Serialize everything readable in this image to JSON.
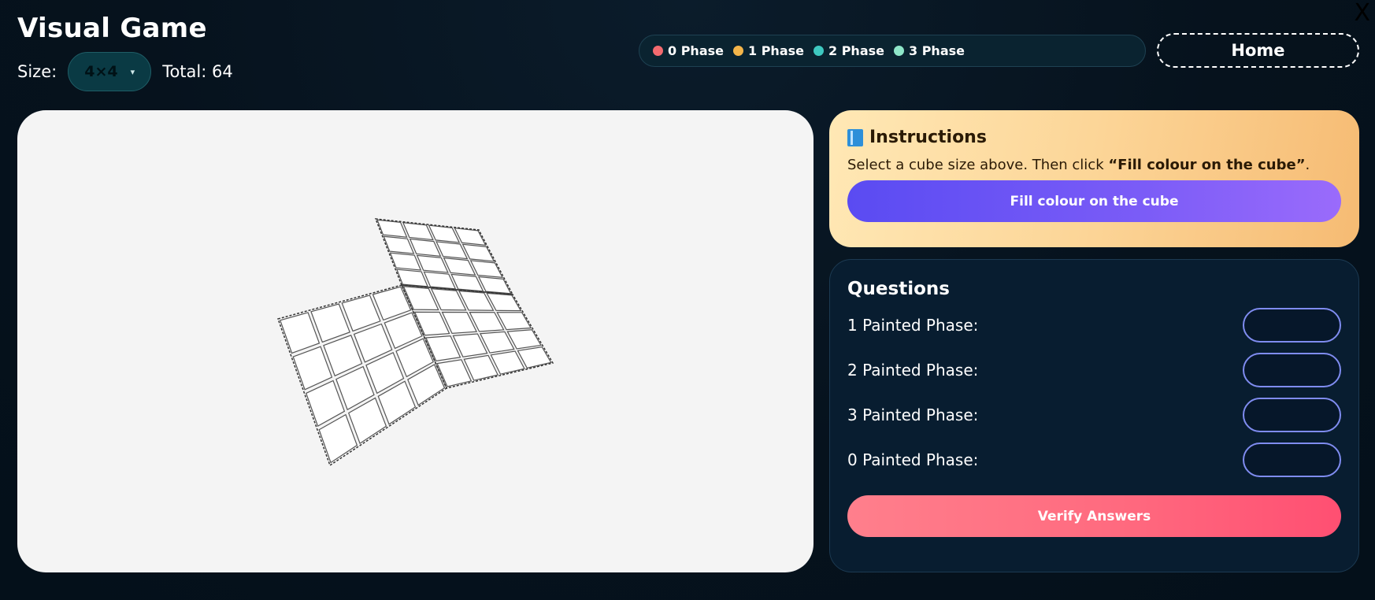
{
  "app": {
    "title": "Visual Game",
    "close_glyph": "X"
  },
  "size": {
    "label": "Size:",
    "selected": "4×4",
    "arrow": "▾",
    "total": "Total: 64",
    "grid_n": 4
  },
  "legend": [
    {
      "label": "0 Phase",
      "color": "#f36a6f"
    },
    {
      "label": "1 Phase",
      "color": "#f4b54a"
    },
    {
      "label": "2 Phase",
      "color": "#3ec8c0"
    },
    {
      "label": "3 Phase",
      "color": "#8ee6c9"
    }
  ],
  "home_label": "Home",
  "instructions": {
    "icon": "book-icon",
    "title": "Instructions",
    "text_prefix": "Select a cube size above. Then click ",
    "text_bold": "“Fill colour on the cube”",
    "text_suffix": ".",
    "button_label": "Fill colour on the cube"
  },
  "questions": {
    "title": "Questions",
    "items": [
      {
        "label": "1 Painted Phase:",
        "value": ""
      },
      {
        "label": "2 Painted Phase:",
        "value": ""
      },
      {
        "label": "3 Painted Phase:",
        "value": ""
      },
      {
        "label": "0 Painted Phase:",
        "value": ""
      }
    ],
    "verify_label": "Verify Answers"
  }
}
